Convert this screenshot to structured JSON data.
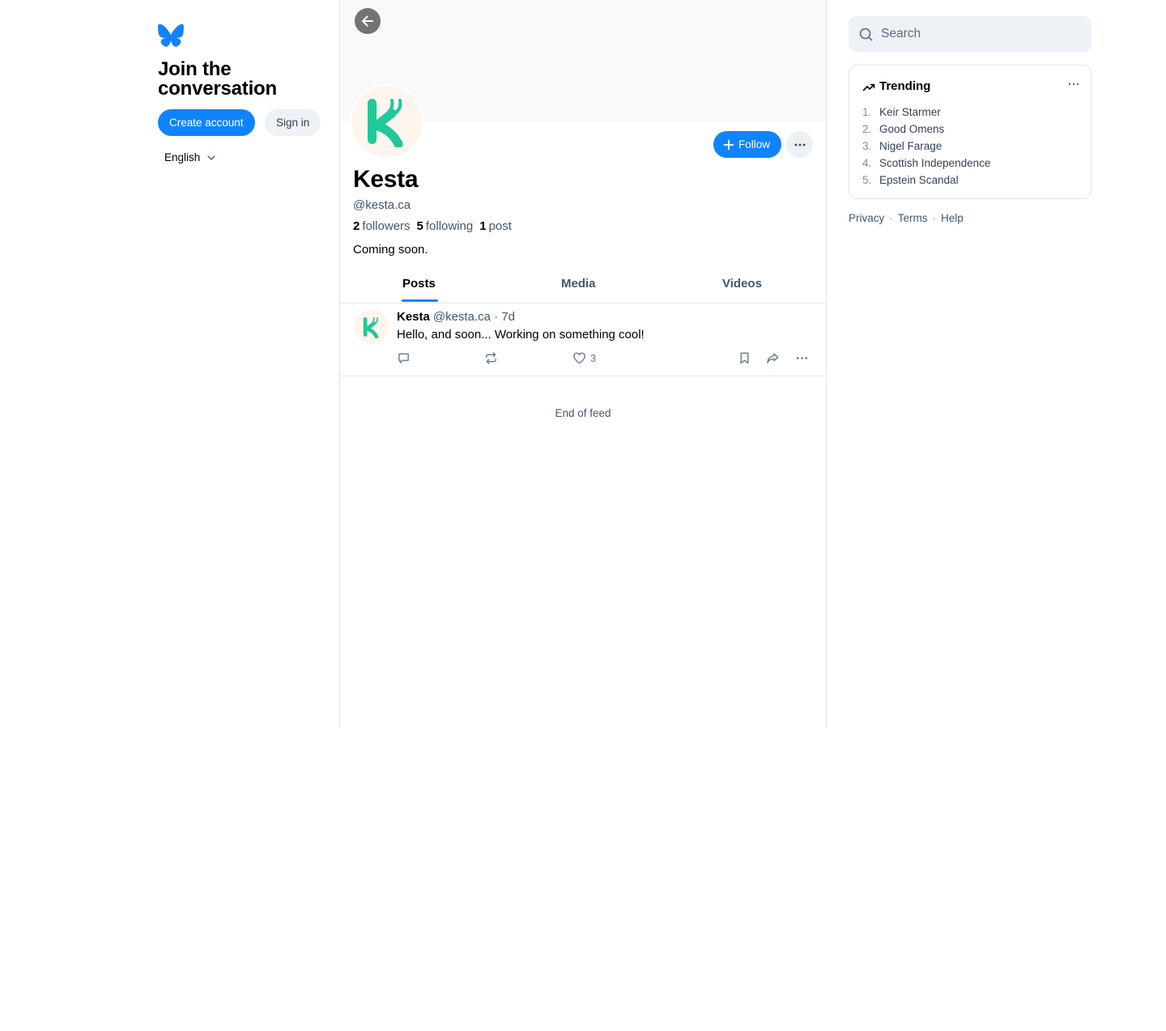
{
  "sidebar": {
    "logo": "butterfly-logo",
    "title": "Join the conversation",
    "create_account": "Create account",
    "sign_in": "Sign in",
    "language": "English"
  },
  "profile": {
    "display_name": "Kesta",
    "handle": "@kesta.ca",
    "followers_count": "2",
    "followers_label": "followers",
    "following_count": "5",
    "following_label": "following",
    "posts_count": "1",
    "posts_label": "post",
    "bio": "Coming soon.",
    "follow_label": "Follow"
  },
  "tabs": [
    {
      "label": "Posts",
      "active": true
    },
    {
      "label": "Media",
      "active": false
    },
    {
      "label": "Videos",
      "active": false
    }
  ],
  "post": {
    "author": "Kesta",
    "handle": "@kesta.ca",
    "separator": "·",
    "time": "7d",
    "text": "Hello, and soon... Working on something cool!",
    "likes": "3"
  },
  "feed_end": "End of feed",
  "search": {
    "placeholder": "Search"
  },
  "trending": {
    "title": "Trending",
    "items": [
      {
        "rank": "1.",
        "label": "Keir Starmer"
      },
      {
        "rank": "2.",
        "label": "Good Omens"
      },
      {
        "rank": "3.",
        "label": "Nigel Farage"
      },
      {
        "rank": "4.",
        "label": "Scottish Independence"
      },
      {
        "rank": "5.",
        "label": "Epstein Scandal"
      }
    ]
  },
  "footer": {
    "privacy": "Privacy",
    "terms": "Terms",
    "help": "Help",
    "sep": "·"
  },
  "colors": {
    "accent": "#1083fe",
    "text_muted": "#42576c",
    "avatar_green": "#20c997"
  }
}
